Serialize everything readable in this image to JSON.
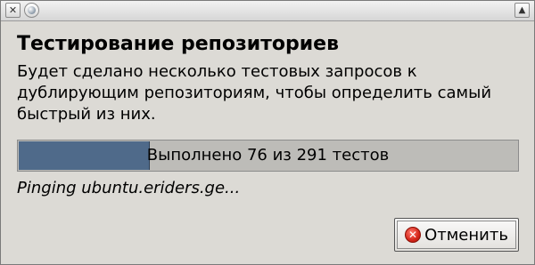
{
  "titlebar": {
    "close_glyph": "✕",
    "maximize_glyph": "▲",
    "icons": {
      "close": "close-icon",
      "app": "app-icon",
      "maximize": "maximize-icon"
    }
  },
  "dialog": {
    "heading": "Тестирование репозиториев",
    "description_lines": [
      "Будет сделано несколько тестовых запросов к",
      "дублирующим репозиториям, чтобы определить самый",
      "быстрый из них."
    ],
    "progress": {
      "text": "Выполнено 76 из 291 тестов",
      "completed": 76,
      "total": 291,
      "fill_color": "#4f6a8a"
    },
    "status": "Pinging ubuntu.eriders.ge...",
    "cancel_button": {
      "label": "Отменить",
      "icon": "cancel-icon",
      "icon_glyph": "✕"
    }
  }
}
